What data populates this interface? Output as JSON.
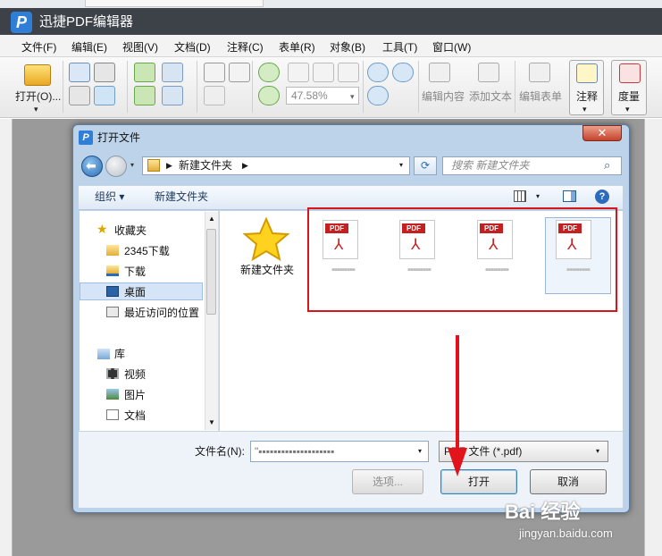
{
  "app": {
    "title": "迅捷PDF编辑器",
    "logo_letter": "P"
  },
  "menu": [
    "文件(F)",
    "编辑(E)",
    "视图(V)",
    "文档(D)",
    "注释(C)",
    "表单(R)",
    "对象(B)",
    "工具(T)",
    "窗口(W)"
  ],
  "toolbar": {
    "open_label": "打开(O)...",
    "zoom_value": "47.58%",
    "edit_content": "编辑内容",
    "add_text": "添加文本",
    "edit_form": "编辑表单",
    "comment": "注释",
    "measure": "度量"
  },
  "dialog": {
    "title": "打开文件",
    "close": "✕",
    "address": "新建文件夹",
    "search_placeholder": "搜索 新建文件夹",
    "organize": "组织 ▾",
    "new_folder": "新建文件夹",
    "nav": {
      "favorites": "收藏夹",
      "fav_items": [
        "2345下载",
        "下载",
        "桌面",
        "最近访问的位置"
      ],
      "library": "库",
      "lib_items": [
        "视频",
        "图片",
        "文档"
      ]
    },
    "files": [
      {
        "type": "folder",
        "name": "新建文件夹"
      },
      {
        "type": "pdf",
        "tag": "PDF",
        "name": "▪▪▪▪▪▪▪▪▪"
      },
      {
        "type": "pdf",
        "tag": "PDF",
        "name": "▪▪▪▪▪▪▪▪▪"
      },
      {
        "type": "pdf",
        "tag": "PDF",
        "name": "▪▪▪▪▪▪▪▪▪"
      },
      {
        "type": "pdf",
        "tag": "PDF",
        "name": "▪▪▪▪▪▪▪▪▪"
      }
    ],
    "filename_label": "文件名(N):",
    "filename_value": "\"▪▪▪▪▪▪▪▪▪▪▪▪▪▪▪▪▪▪▪▪",
    "filter_value": "PDF 文件 (*.pdf)",
    "options_label": "选项...",
    "open_label": "打开",
    "cancel_label": "取消"
  },
  "watermark": {
    "brand": "Bai 经验",
    "url": "jingyan.baidu.com"
  },
  "colors": {
    "highlight_red": "#d5161a",
    "titlebar": "#3d4249"
  }
}
